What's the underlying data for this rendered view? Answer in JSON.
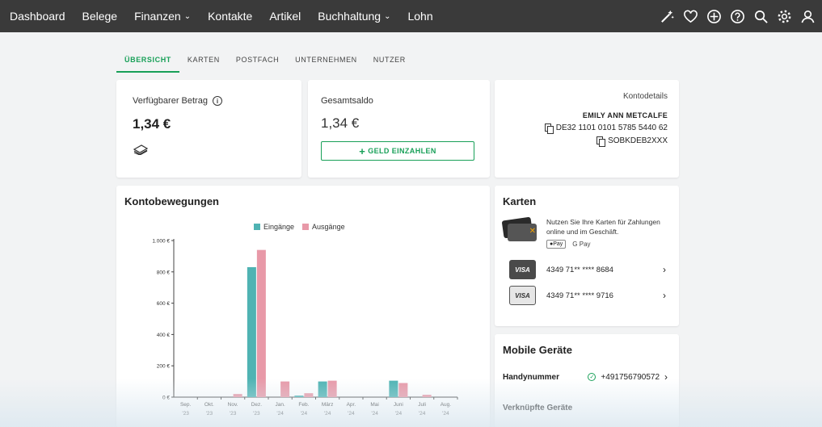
{
  "nav": {
    "items": [
      {
        "label": "Dashboard",
        "dropdown": false
      },
      {
        "label": "Belege",
        "dropdown": false
      },
      {
        "label": "Finanzen",
        "dropdown": true
      },
      {
        "label": "Kontakte",
        "dropdown": false
      },
      {
        "label": "Artikel",
        "dropdown": false
      },
      {
        "label": "Buchhaltung",
        "dropdown": true
      },
      {
        "label": "Lohn",
        "dropdown": false
      }
    ],
    "icons": [
      "magic-wand-icon",
      "heart-icon",
      "plus-circle-icon",
      "help-icon",
      "search-icon",
      "gear-icon",
      "user-icon"
    ]
  },
  "tabs": [
    "ÜBERSICHT",
    "KARTEN",
    "POSTFACH",
    "UNTERNEHMEN",
    "NUTZER"
  ],
  "balance": {
    "label": "Verfügbarer Betrag",
    "value": "1,34 €"
  },
  "total": {
    "label": "Gesamtsaldo",
    "value": "1,34 €",
    "button": "GELD EINZAHLEN"
  },
  "account": {
    "title": "Kontodetails",
    "name": "EMILY ANN METCALFE",
    "iban": "DE32 1101 0101 5785 5440 62",
    "bic": "SOBKDEB2XXX"
  },
  "movements": {
    "title": "Kontobewegungen"
  },
  "cards": {
    "title": "Karten",
    "promo": "Nutzen Sie Ihre Karten für Zahlungen online und im Geschäft.",
    "apple_pay": "Pay",
    "google_pay": "G Pay",
    "list": [
      {
        "brand": "VISA",
        "number": "4349 71** **** 8684",
        "style": "dark"
      },
      {
        "brand": "VISA",
        "number": "4349 71** **** 9716",
        "style": "light"
      }
    ]
  },
  "mobile": {
    "title": "Mobile Geräte",
    "phone_label": "Handynummer",
    "phone": "+491756790572",
    "linked_label": "Verknüpfte Geräte"
  },
  "colors": {
    "accent": "#18a058",
    "incoming": "#4fb3b3",
    "outgoing": "#e899a8",
    "topbar": "#3a3a3a"
  },
  "chart_data": {
    "type": "bar",
    "categories": [
      [
        "Sep.",
        "'23"
      ],
      [
        "Okt.",
        "'23"
      ],
      [
        "Nov.",
        "'23"
      ],
      [
        "Dez.",
        "'23"
      ],
      [
        "Jan.",
        "'24"
      ],
      [
        "Feb.",
        "'24"
      ],
      [
        "März",
        "'24"
      ],
      [
        "Apr.",
        "'24"
      ],
      [
        "Mai",
        "'24"
      ],
      [
        "Juni",
        "'24"
      ],
      [
        "Juli",
        "'24"
      ],
      [
        "Aug.",
        "'24"
      ]
    ],
    "series": [
      {
        "name": "Eingänge",
        "values": [
          0,
          0,
          0,
          830,
          0,
          10,
          100,
          0,
          0,
          105,
          0,
          0
        ]
      },
      {
        "name": "Ausgänge",
        "values": [
          0,
          0,
          20,
          940,
          100,
          25,
          105,
          0,
          0,
          90,
          15,
          0
        ]
      }
    ],
    "yticks": [
      "0 €",
      "200 €",
      "400 €",
      "600 €",
      "800 €",
      "1.000 €"
    ],
    "ylim": [
      0,
      1000
    ],
    "legend": "top",
    "grid": false
  }
}
